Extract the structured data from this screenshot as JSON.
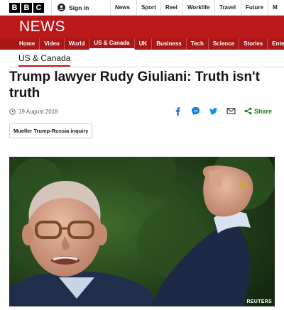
{
  "topbar": {
    "logo_letters": [
      "B",
      "B",
      "C"
    ],
    "signin_label": "Sign in",
    "nav": [
      "News",
      "Sport",
      "Reel",
      "Worklife",
      "Travel",
      "Future",
      "M"
    ]
  },
  "banner": {
    "title": "NEWS",
    "color": "#bb1919",
    "sections": [
      "Home",
      "Video",
      "World",
      "US & Canada",
      "UK",
      "Business",
      "Tech",
      "Science",
      "Stories",
      "Enter"
    ],
    "active_section": "US & Canada"
  },
  "breadcrumb": "US & Canada",
  "article": {
    "headline": "Trump lawyer Rudy Giuliani: Truth isn't truth",
    "date": "19 August 2018",
    "share_label": "Share",
    "tag": "Mueller Trump-Russia inquiry",
    "image_credit": "REUTERS"
  },
  "icons": {
    "share": [
      "facebook-icon",
      "messenger-icon",
      "twitter-icon",
      "email-icon",
      "share-icon"
    ]
  }
}
